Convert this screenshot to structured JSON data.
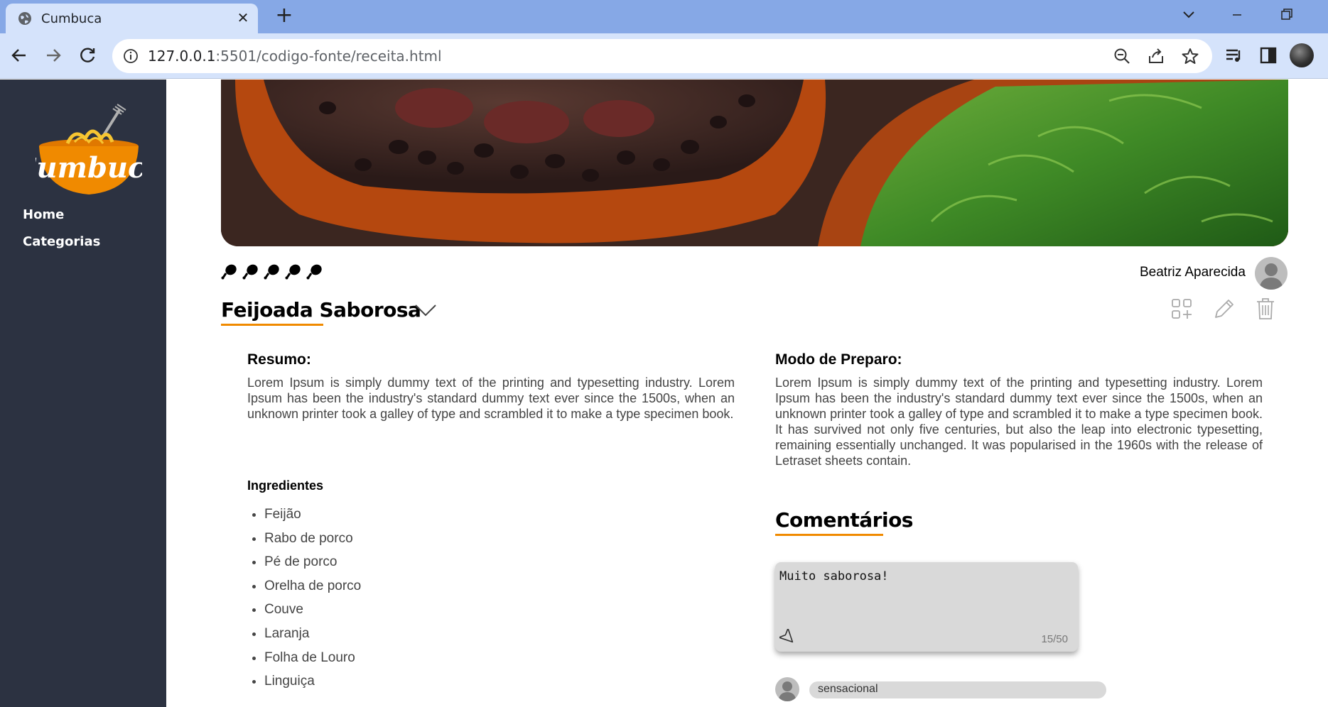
{
  "browser": {
    "tab_title": "Cumbuca",
    "tab_close": "✕",
    "new_tab": "+",
    "url_host": "127.0.0.1",
    "url_rest": ":5501/codigo-fonte/receita.html"
  },
  "sidebar": {
    "logo_text": "Cumbuca",
    "links": [
      {
        "label": "Home"
      },
      {
        "label": "Categorias"
      }
    ]
  },
  "recipe": {
    "rating": 5,
    "author": "Beatriz Aparecida",
    "title": "Feijoada Saborosa",
    "summary": {
      "heading": "Resumo:",
      "text": "Lorem Ipsum is simply dummy text of the printing and typesetting industry. Lorem Ipsum has been the industry's standard dummy text ever since the 1500s, when an unknown printer took a galley of type and scrambled it to make a type specimen book."
    },
    "ingredients": {
      "heading": "Ingredientes",
      "items": [
        "Feijão",
        "Rabo de porco",
        "Pé de porco",
        "Orelha de porco",
        "Couve",
        "Laranja",
        "Folha de Louro",
        "Linguiça"
      ]
    },
    "preparation": {
      "heading": "Modo de Preparo:",
      "text": "Lorem Ipsum is simply dummy text of the printing and typesetting industry. Lorem Ipsum has been the industry's standard dummy text ever since the 1500s, when an unknown printer took a galley of type and scrambled it to make a type specimen book. It has survived not only five centuries, but also the leap into electronic typesetting, remaining essentially unchanged. It was popularised in the 1960s with the release of Letraset sheets contain."
    }
  },
  "comments": {
    "heading": "Comentários",
    "input_value": "Muito saborosa!",
    "char_count": "15/50",
    "list": [
      {
        "text": "sensacional"
      }
    ]
  },
  "colors": {
    "accent": "#f08a00",
    "sidebar_bg": "#2c3241",
    "chrome_titlebar": "#86a8e6",
    "chrome_toolbar": "#d5e3fb"
  }
}
